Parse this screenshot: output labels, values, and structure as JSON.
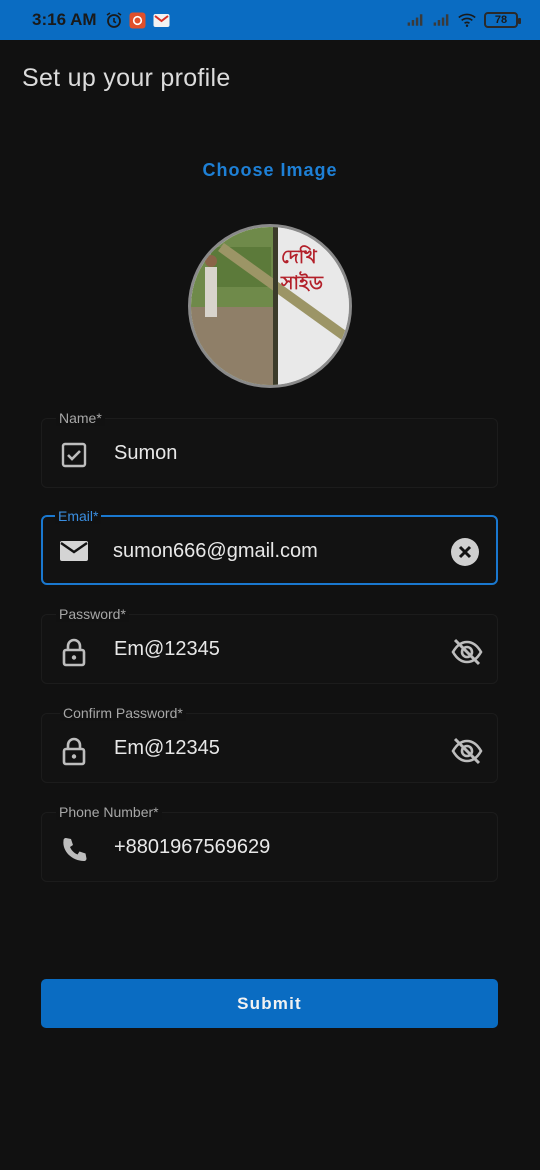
{
  "status_bar": {
    "time": "3:16 AM",
    "battery": "78",
    "icons": [
      "alarm-icon",
      "app-notification-icon",
      "gmail-icon",
      "signal-icon",
      "signal-icon",
      "wifi-icon"
    ]
  },
  "header": {
    "title": "Set up your profile"
  },
  "choose_image": {
    "label": "Choose Image"
  },
  "avatar": {
    "text_line1": "দেখি",
    "text_line2": "সাইড"
  },
  "form": {
    "name": {
      "label": "Name*",
      "value": "Sumon",
      "icon": "checkbox-icon"
    },
    "email": {
      "label": "Email*",
      "value": "sumon666@gmail.com",
      "icon": "mail-icon",
      "trailing": "clear-icon"
    },
    "password": {
      "label": "Password*",
      "value": "Em@12345",
      "icon": "lock-icon",
      "trailing": "visibility-off-icon"
    },
    "confirm_password": {
      "label": "Confirm Password*",
      "value": "Em@12345",
      "icon": "lock-icon",
      "trailing": "visibility-off-icon"
    },
    "phone": {
      "label": "Phone Number*",
      "value": "+8801967569629",
      "icon": "phone-icon"
    }
  },
  "submit": {
    "label": "Submit"
  },
  "colors": {
    "accent": "#0a6cc2",
    "background": "#111111",
    "link": "#1e80d6"
  }
}
